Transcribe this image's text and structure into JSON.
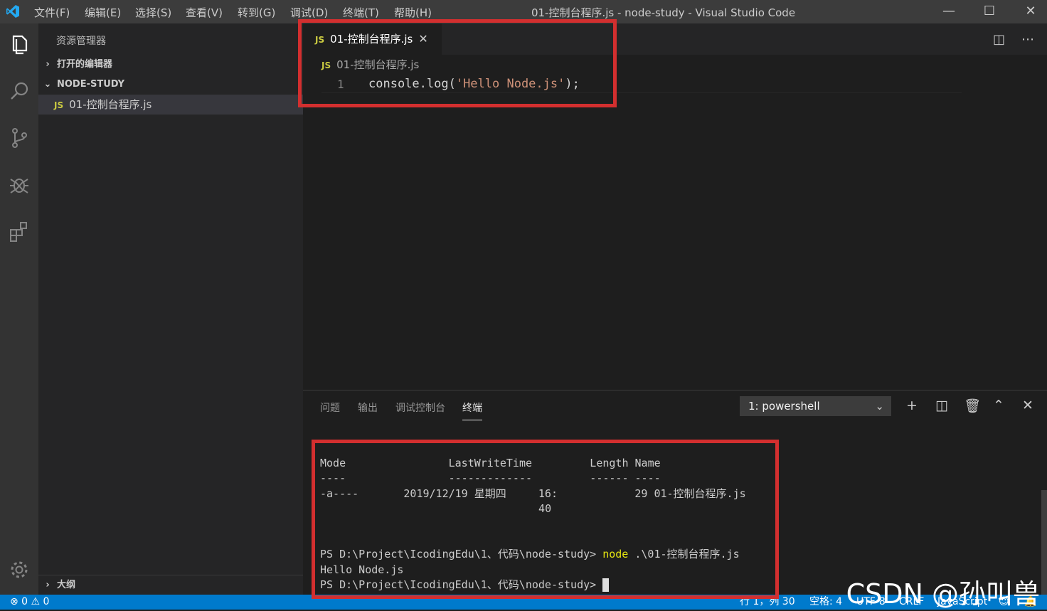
{
  "titlebar": {
    "menu": [
      "文件(F)",
      "编辑(E)",
      "选择(S)",
      "查看(V)",
      "转到(G)",
      "调试(D)",
      "终端(T)",
      "帮助(H)"
    ],
    "window_title": "01-控制台程序.js - node-study - Visual Studio Code",
    "controls": {
      "minimize": "—",
      "maximize": "☐",
      "close": "✕"
    }
  },
  "activitybar": {
    "icons": [
      "explorer-icon",
      "search-icon",
      "source-control-icon",
      "debug-icon",
      "extensions-icon",
      "settings-gear-icon"
    ]
  },
  "sidebar": {
    "title": "资源管理器",
    "open_editors": "打开的编辑器",
    "folder": "NODE-STUDY",
    "file": "01-控制台程序.js",
    "js_badge": "JS",
    "outline": "大纲"
  },
  "editor": {
    "tab_label": "01-控制台程序.js",
    "tab_close": "✕",
    "breadcrumb": "01-控制台程序.js",
    "line_number": "1",
    "code": {
      "prefix": "console.log(",
      "string": "'Hello Node.js'",
      "suffix": ");"
    }
  },
  "panel": {
    "tabs": [
      "问题",
      "输出",
      "调试控制台",
      "终端"
    ],
    "terminal_select": "1: powershell",
    "terminal": {
      "header": "Mode                LastWriteTime         Length Name",
      "divider": "----                -------------         ------ ----",
      "row1": "-a----       2019/12/19 星期四     16:            29 01-控制台程序.js",
      "row2": "                                  40",
      "blank1": " ",
      "blank2": " ",
      "prompt1_path": "PS D:\\Project\\IcodingEdu\\1、代码\\node-study> ",
      "prompt1_cmd": "node",
      "prompt1_arg": " .\\01-控制台程序.js",
      "output": "Hello Node.js",
      "prompt2": "PS D:\\Project\\IcodingEdu\\1、代码\\node-study> "
    }
  },
  "statusbar": {
    "problems": "⊗ 0 ⚠ 0",
    "position": "行 1，列 30",
    "spaces": "空格: 4",
    "encoding": "UTF-8",
    "eol": "CRLF",
    "language": "JavaScript"
  },
  "watermark": "CSDN @孙叫兽",
  "colors": {
    "highlight_box": "#d32f2f",
    "statusbar": "#007acc",
    "js_badge": "#cbcb41",
    "string": "#ce9178"
  }
}
